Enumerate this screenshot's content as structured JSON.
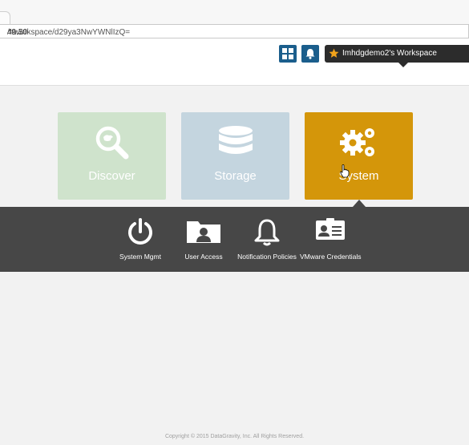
{
  "browser": {
    "url_host": "49.50",
    "url_path": "/#workspace/d29ya3NwYWNlIzQ="
  },
  "header": {
    "dashboard_icon": "grid-icon",
    "notifications_icon": "bell-icon",
    "workspace_label": "Imhdgdemo2's Workspace",
    "workspace_star_color": "#f2a31b",
    "header_button_color": "#1b5e8c"
  },
  "tiles": [
    {
      "label": "Discover",
      "icon": "search-icon",
      "color": "#cfe3cc"
    },
    {
      "label": "Storage",
      "icon": "database-icon",
      "color": "#c4d5df"
    },
    {
      "label": "System",
      "icon": "gears-icon",
      "color": "#d4960a",
      "active": true
    }
  ],
  "submenu": {
    "items": [
      {
        "label": "System Mgmt",
        "icon": "power-icon"
      },
      {
        "label": "User Access",
        "icon": "user-folder-icon"
      },
      {
        "label": "Notification Policies",
        "icon": "bell-icon"
      },
      {
        "label": "VMware Credentials",
        "icon": "id-card-icon"
      }
    ]
  },
  "footer": {
    "copyright": "Copyright © 2015 DataGravity, Inc. All Rights Reserved."
  }
}
